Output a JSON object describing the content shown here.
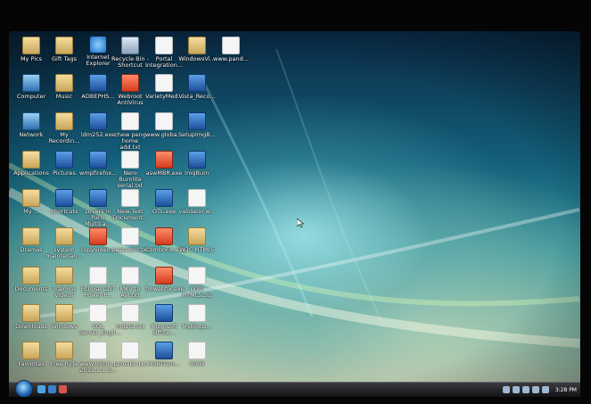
{
  "desktop": {
    "icons": [
      {
        "label": "My Pics",
        "icon": "folder"
      },
      {
        "label": "Gift Tags",
        "icon": "folder"
      },
      {
        "label": "Internet\nExplorer",
        "icon": "ie"
      },
      {
        "label": "Recycle Bin -\nShortcut",
        "icon": "recycle-bin"
      },
      {
        "label": "Portal\nIntegration...",
        "icon": "document"
      },
      {
        "label": "WindowsVi...",
        "icon": "folder"
      },
      {
        "label": "www.pand...",
        "icon": "document"
      },
      {
        "label": "Computer",
        "icon": "computer"
      },
      {
        "label": "Music",
        "icon": "music"
      },
      {
        "label": "ADBEPHS...",
        "icon": "app"
      },
      {
        "label": "Webroot\nAntiVirus",
        "icon": "red-app"
      },
      {
        "label": "VarietyMed...",
        "icon": "document"
      },
      {
        "label": "Vista_Reco...",
        "icon": "app"
      },
      {
        "label": "Network",
        "icon": "network"
      },
      {
        "label": "My\nRecordin...",
        "icon": "folder"
      },
      {
        "label": "ldm252.exe",
        "icon": "app"
      },
      {
        "label": "chew peng\nhome add.txt",
        "icon": "document"
      },
      {
        "label": "www.globa...",
        "icon": "document"
      },
      {
        "label": "SetupImgB...",
        "icon": "app"
      },
      {
        "label": "Applications",
        "icon": "folder"
      },
      {
        "label": "Pictures",
        "icon": "app"
      },
      {
        "label": "wmpfirefox...",
        "icon": "app"
      },
      {
        "label": "Nero Burnlite\nserial.txt",
        "icon": "document"
      },
      {
        "label": "aswMBR.exe",
        "icon": "red-app"
      },
      {
        "label": "ImgBurn",
        "icon": "app"
      },
      {
        "label": "My ...",
        "icon": "folder"
      },
      {
        "label": "Shortcuts",
        "icon": "app"
      },
      {
        "label": "Lovers in\nParis MultiLa...",
        "icon": "app"
      },
      {
        "label": "New Text\nDocument...",
        "icon": "document"
      },
      {
        "label": "OTL.exe",
        "icon": "app"
      },
      {
        "label": "validator.w...",
        "icon": "document"
      },
      {
        "label": "Dramas",
        "icon": "folder"
      },
      {
        "label": "system\nmaintenan...",
        "icon": "folder"
      },
      {
        "label": "copyvideo...",
        "icon": "red-app"
      },
      {
        "label": "password.txt",
        "icon": "document"
      },
      {
        "label": "ComboFix.exe",
        "icon": "red-app"
      },
      {
        "label": "W3C HTML5",
        "icon": "folder"
      },
      {
        "label": "Documents",
        "icon": "folder"
      },
      {
        "label": "Training\nVideos",
        "icon": "folder"
      },
      {
        "label": "Eclipse CDT\nPower P...",
        "icon": "document"
      },
      {
        "label": "MKV to\nAVI.txt",
        "icon": "document"
      },
      {
        "label": "fmwebfix.exe",
        "icon": "red-app"
      },
      {
        "label": "W3C\nHTML5.zip",
        "icon": "document"
      },
      {
        "label": "Downloads",
        "icon": "folder"
      },
      {
        "label": "Windows",
        "icon": "folder"
      },
      {
        "label": "SQL\nServer_Engli...",
        "icon": "document"
      },
      {
        "label": "mdpte.txt",
        "icon": "document"
      },
      {
        "label": "Microsoft\nOffice...",
        "icon": "app"
      },
      {
        "label": "MyBlogs...",
        "icon": "document"
      },
      {
        "label": "Favorites",
        "icon": "folder"
      },
      {
        "label": "Free Ride",
        "icon": "folder"
      },
      {
        "label": "www.micro...\n2021.1.1 S...",
        "icon": "document"
      },
      {
        "label": "pcmatic.txt",
        "icon": "document"
      },
      {
        "label": "MSRTCon...",
        "icon": "app"
      },
      {
        "label": "C003",
        "icon": "document"
      }
    ]
  },
  "taskbar": {
    "clock": "3:28 PM"
  },
  "colors": {
    "taskbar": "#1b1b1f",
    "start_orb": "#1e5fae"
  }
}
